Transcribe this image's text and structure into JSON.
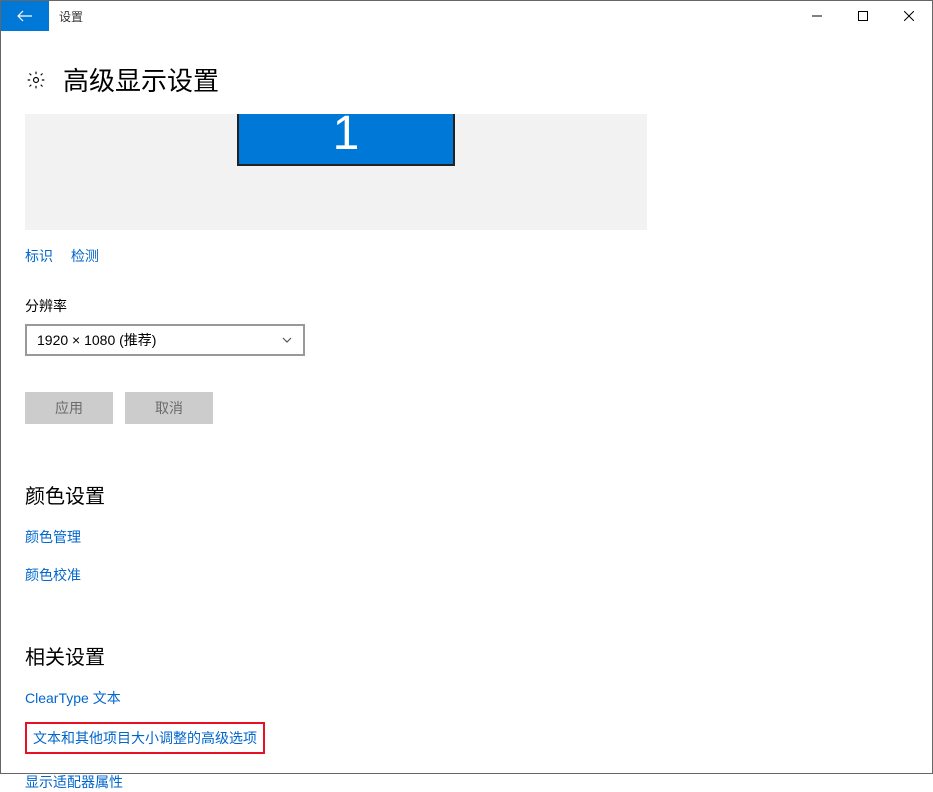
{
  "window": {
    "title": "设置"
  },
  "page": {
    "title": "高级显示设置"
  },
  "monitor": {
    "label": "1"
  },
  "display_links": {
    "identify": "标识",
    "detect": "检测"
  },
  "resolution": {
    "label": "分辨率",
    "value": "1920 × 1080 (推荐)"
  },
  "buttons": {
    "apply": "应用",
    "cancel": "取消"
  },
  "color_section": {
    "heading": "颜色设置",
    "management": "颜色管理",
    "calibration": "颜色校准"
  },
  "related_section": {
    "heading": "相关设置",
    "cleartype": "ClearType 文本",
    "advanced_sizing": "文本和其他项目大小调整的高级选项",
    "adapter_properties": "显示适配器属性"
  }
}
